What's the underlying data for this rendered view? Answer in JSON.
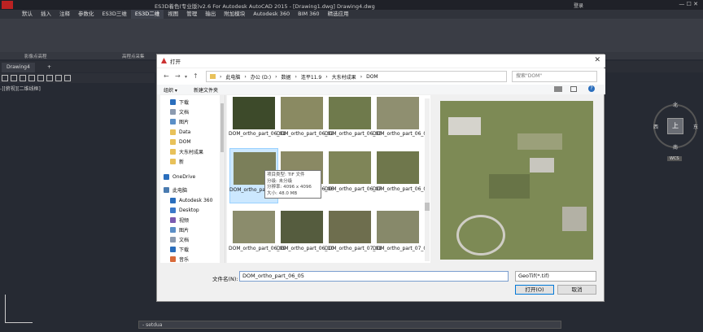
{
  "app": {
    "title": "ES3D着色(专业版)v2.6 For Autodesk AutoCAD 2015 - [Drawing1.dwg]  Drawing4.dwg",
    "login_label": "登录"
  },
  "menubar": {
    "items": [
      "默认",
      "插入",
      "注释",
      "参数化",
      "ES3D三维",
      "ES3D二维",
      "视图",
      "管理",
      "输出",
      "附加模块",
      "Autodesk 360",
      "BIM 360",
      "精选应用"
    ],
    "active_index": 5
  },
  "ribbon": {
    "panels": [
      "影像点高程",
      "高程点采集"
    ]
  },
  "doc_tabs": {
    "tabs": [
      "Drawing4",
      "+"
    ]
  },
  "viewport": {
    "label": "-][俯视][二维线框]"
  },
  "compass": {
    "north": "北",
    "south": "南",
    "east": "东",
    "west": "西",
    "top": "上",
    "wcs": "WCS"
  },
  "command_line": {
    "value": "- setdua"
  },
  "dialog": {
    "title": "打开",
    "close_label": "✕",
    "breadcrumb": [
      "此电脑",
      "办公 (D:)",
      "数据",
      "连平11.9",
      "大东村成果",
      "DOM"
    ],
    "search_placeholder": "搜索\"DOM\"",
    "toolbar": {
      "organize": "组织 ▾",
      "new_folder": "新建文件夹"
    },
    "nav": [
      {
        "label": "下载",
        "icon": "download-icon"
      },
      {
        "label": "文档",
        "icon": "document-icon"
      },
      {
        "label": "图片",
        "icon": "picture-icon"
      },
      {
        "label": "Data",
        "icon": "folder-icon"
      },
      {
        "label": "DOM",
        "icon": "folder-icon"
      },
      {
        "label": "大东村成果",
        "icon": "folder-icon"
      },
      {
        "label": "新",
        "icon": "folder-icon"
      },
      {
        "label": "OneDrive",
        "icon": "cloud-icon"
      },
      {
        "label": "此电脑",
        "icon": "computer-icon"
      },
      {
        "label": "Autodesk 360",
        "icon": "cloud-icon"
      },
      {
        "label": "Desktop",
        "icon": "desktop-icon"
      },
      {
        "label": "视频",
        "icon": "video-icon"
      },
      {
        "label": "图片",
        "icon": "picture-icon"
      },
      {
        "label": "文档",
        "icon": "document-icon"
      },
      {
        "label": "下载",
        "icon": "download-icon"
      },
      {
        "label": "音乐",
        "icon": "music-icon"
      }
    ],
    "files": [
      {
        "name": "DOM_ortho_part_06_01",
        "color": "#3d4a2a"
      },
      {
        "name": "DOM_ortho_part_06_02",
        "color": "#8a8a62"
      },
      {
        "name": "DOM_ortho_part_06_03",
        "color": "#6f7a4c"
      },
      {
        "name": "DOM_ortho_part_06_04",
        "color": "#8f8f70"
      },
      {
        "name": "DOM_ortho_part_06_05",
        "color": "#7b7f5a"
      },
      {
        "name": "DOM_ortho_part_06_06",
        "color": "#8a8964"
      },
      {
        "name": "DOM_ortho_part_06_07",
        "color": "#7f8558"
      },
      {
        "name": "DOM_ortho_part_06_08",
        "color": "#6f774c"
      },
      {
        "name": "DOM_ortho_part_06_09",
        "color": "#8b8c6c"
      },
      {
        "name": "DOM_ortho_part_06_10",
        "color": "#555c3e"
      },
      {
        "name": "DOM_ortho_part_07_01",
        "color": "#6e6e4e"
      },
      {
        "name": "DOM_ortho_part_07_02",
        "color": "#87896a"
      }
    ],
    "selected_index": 4,
    "tooltip": [
      "项目类型: TIF 文件",
      "分级: 未分级",
      "分辨率: 4096 x 4096",
      "大小: 48.0 MB"
    ],
    "filename_label": "文件名(N):",
    "filename_value": "DOM_ortho_part_06_05",
    "filetype_value": "GeoTif(*.tif)",
    "open_label": "打开(O)",
    "cancel_label": "取消"
  }
}
